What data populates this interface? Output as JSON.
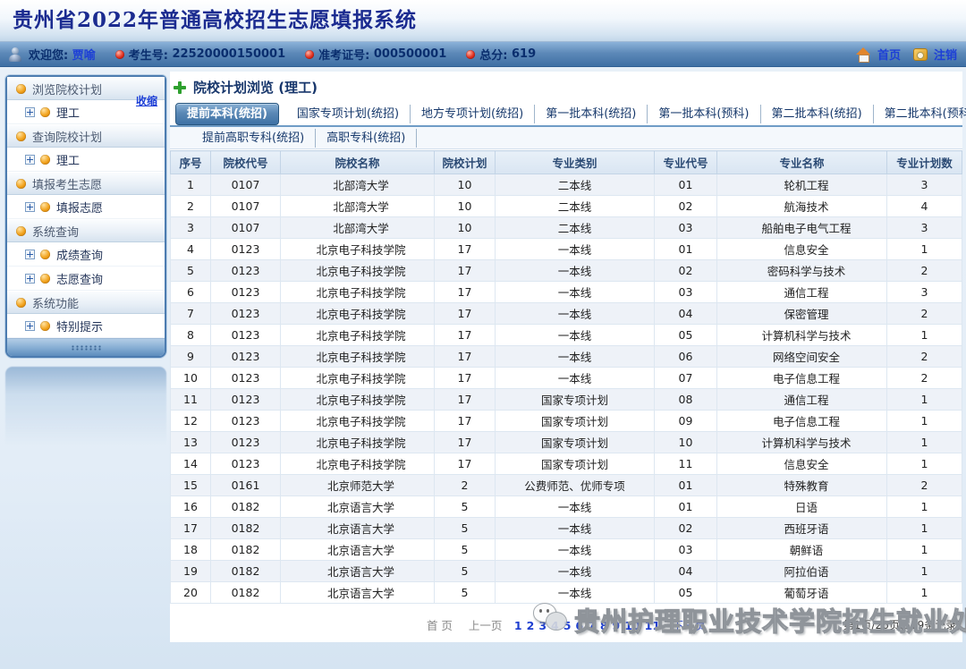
{
  "app": {
    "title": "贵州省2022年普通高校招生志愿填报系统"
  },
  "user_bar": {
    "welcome_label": "欢迎您:",
    "user_name": "贾喻",
    "exam_no_label": "考生号:",
    "exam_no": "22520000150001",
    "ticket_label": "准考证号:",
    "ticket_no": "000500001",
    "score_label": "总分:",
    "score": "619",
    "home_label": "首页",
    "logout_label": "注销"
  },
  "sidebar": {
    "collapse_label": "收缩",
    "groups": [
      {
        "label": "浏览院校计划",
        "items": [
          "理工"
        ]
      },
      {
        "label": "查询院校计划",
        "items": [
          "理工"
        ]
      },
      {
        "label": "填报考生志愿",
        "items": [
          "填报志愿"
        ]
      },
      {
        "label": "系统查询",
        "items": [
          "成绩查询",
          "志愿查询"
        ]
      },
      {
        "label": "系统功能",
        "items": [
          "特别提示"
        ]
      }
    ]
  },
  "main": {
    "page_title": "院校计划浏览 (理工)",
    "active_tab": "提前本科(统招)",
    "tabs_row1": [
      "提前本科(统招)",
      "国家专项计划(统招)",
      "地方专项计划(统招)",
      "第一批本科(统招)",
      "第一批本科(预科)",
      "第二批本科(统招)",
      "第二批本科(预科)"
    ],
    "tabs_row2": [
      "提前高职专科(统招)",
      "高职专科(统招)"
    ],
    "table": {
      "headers": [
        "序号",
        "院校代号",
        "院校名称",
        "院校计划",
        "专业类别",
        "专业代号",
        "专业名称",
        "专业计划数"
      ],
      "rows": [
        [
          "1",
          "0107",
          "北部湾大学",
          "10",
          "二本线",
          "01",
          "轮机工程",
          "3"
        ],
        [
          "2",
          "0107",
          "北部湾大学",
          "10",
          "二本线",
          "02",
          "航海技术",
          "4"
        ],
        [
          "3",
          "0107",
          "北部湾大学",
          "10",
          "二本线",
          "03",
          "船舶电子电气工程",
          "3"
        ],
        [
          "4",
          "0123",
          "北京电子科技学院",
          "17",
          "一本线",
          "01",
          "信息安全",
          "1"
        ],
        [
          "5",
          "0123",
          "北京电子科技学院",
          "17",
          "一本线",
          "02",
          "密码科学与技术",
          "2"
        ],
        [
          "6",
          "0123",
          "北京电子科技学院",
          "17",
          "一本线",
          "03",
          "通信工程",
          "3"
        ],
        [
          "7",
          "0123",
          "北京电子科技学院",
          "17",
          "一本线",
          "04",
          "保密管理",
          "2"
        ],
        [
          "8",
          "0123",
          "北京电子科技学院",
          "17",
          "一本线",
          "05",
          "计算机科学与技术",
          "1"
        ],
        [
          "9",
          "0123",
          "北京电子科技学院",
          "17",
          "一本线",
          "06",
          "网络空间安全",
          "2"
        ],
        [
          "10",
          "0123",
          "北京电子科技学院",
          "17",
          "一本线",
          "07",
          "电子信息工程",
          "2"
        ],
        [
          "11",
          "0123",
          "北京电子科技学院",
          "17",
          "国家专项计划",
          "08",
          "通信工程",
          "1"
        ],
        [
          "12",
          "0123",
          "北京电子科技学院",
          "17",
          "国家专项计划",
          "09",
          "电子信息工程",
          "1"
        ],
        [
          "13",
          "0123",
          "北京电子科技学院",
          "17",
          "国家专项计划",
          "10",
          "计算机科学与技术",
          "1"
        ],
        [
          "14",
          "0123",
          "北京电子科技学院",
          "17",
          "国家专项计划",
          "11",
          "信息安全",
          "1"
        ],
        [
          "15",
          "0161",
          "北京师范大学",
          "2",
          "公费师范、优师专项",
          "01",
          "特殊教育",
          "2"
        ],
        [
          "16",
          "0182",
          "北京语言大学",
          "5",
          "一本线",
          "01",
          "日语",
          "1"
        ],
        [
          "17",
          "0182",
          "北京语言大学",
          "5",
          "一本线",
          "02",
          "西班牙语",
          "1"
        ],
        [
          "18",
          "0182",
          "北京语言大学",
          "5",
          "一本线",
          "03",
          "朝鲜语",
          "1"
        ],
        [
          "19",
          "0182",
          "北京语言大学",
          "5",
          "一本线",
          "04",
          "阿拉伯语",
          "1"
        ],
        [
          "20",
          "0182",
          "北京语言大学",
          "5",
          "一本线",
          "05",
          "葡萄牙语",
          "1"
        ]
      ]
    },
    "pagination": {
      "first": "首 页",
      "prev": "上一页",
      "pages": [
        "1",
        "2",
        "3",
        "4",
        "5",
        "6",
        "7",
        "8",
        "9",
        "10",
        "11"
      ],
      "next": "下一页",
      "info": "第1页/26页(519条记录)"
    }
  },
  "watermark": {
    "text": "贵州护理职业技术学院招生就业处"
  }
}
